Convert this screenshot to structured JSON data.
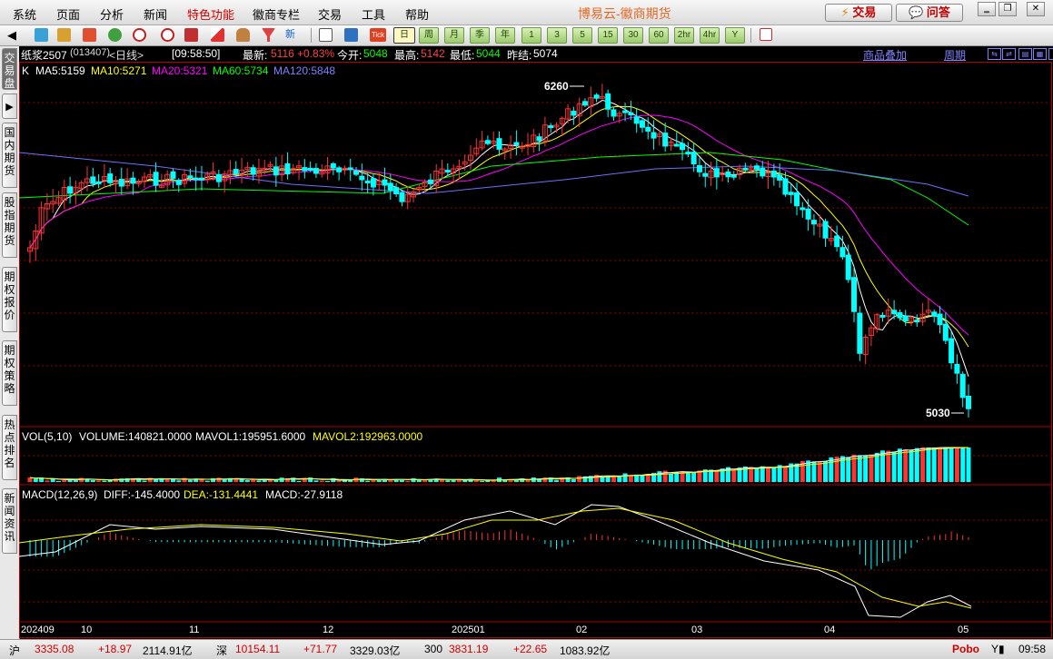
{
  "menu": {
    "items": [
      "系统",
      "页面",
      "分析",
      "新闻",
      "特色功能",
      "徽商专栏",
      "交易",
      "工具",
      "帮助"
    ],
    "highlight_index": 4,
    "app_title": "博易云-徽商期货",
    "trade_button": "交易",
    "qa_button": "问答"
  },
  "toolbar": {
    "periods": [
      "日",
      "周",
      "月",
      "季",
      "年",
      "1",
      "3",
      "5",
      "15",
      "30",
      "60",
      "2hr",
      "4hr",
      "Y"
    ],
    "selected_period": "日",
    "new_label": "新",
    "tick_label": "Tick"
  },
  "left_tabs": [
    "交易盘 3",
    "国内期货",
    "股指期货",
    "期权报价",
    "期权策略",
    "热点排名",
    "新闻资讯"
  ],
  "info": {
    "contract": "纸浆2507",
    "code": "(013407)",
    "period_label": "<日线>",
    "time": "[09:58:50]",
    "latest_label": "最新:",
    "latest": "5116",
    "change_pct": "+0.83%",
    "open_label": "今开:",
    "open": "5048",
    "high_label": "最高:",
    "high": "5142",
    "low_label": "最低:",
    "low": "5044",
    "prevsettle_label": "昨结:",
    "prevsettle": "5074",
    "overlay_link": "商品叠加",
    "period_link": "周期"
  },
  "ma_legend": {
    "k": "K",
    "ma5": "MA5:5159",
    "ma10": "MA10:5271",
    "ma20": "MA20:5321",
    "ma60": "MA60:5734",
    "ma120": "MA120:5848"
  },
  "vol_legend": {
    "name": "VOL(5,10)",
    "volume": "VOLUME:140821.0000",
    "mavol1": "MAVOL1:195951.6000",
    "mavol2": "MAVOL2:192963.0000"
  },
  "macd_legend": {
    "name": "MACD(12,26,9)",
    "diff": "DIFF:-145.4000",
    "dea": "DEA:-131.4441",
    "macd": "MACD:-27.9118"
  },
  "annotations": {
    "high_price": "6260",
    "low_price": "5030"
  },
  "x_axis_labels": [
    "202409",
    "10",
    "11",
    "12",
    "202501",
    "02",
    "03",
    "04",
    "05"
  ],
  "colors": {
    "up": "#ff3232",
    "down": "#00ffff",
    "ma5": "#ffffff",
    "ma10": "#ffff00",
    "ma20": "#ff00ff",
    "ma60": "#00ff00",
    "ma120": "#6f6fff"
  },
  "chart_data": {
    "type": "candlestick",
    "contract": "纸浆2507",
    "period": "daily",
    "date_range": [
      "2024-09",
      "2025-05"
    ],
    "price_ylim": [
      5000,
      6300
    ],
    "key_levels": {
      "high": 6260,
      "low": 5030
    },
    "last": {
      "latest": 5116,
      "open": 5048,
      "high": 5142,
      "low": 5044,
      "prev_settle": 5074
    },
    "volume": {
      "last": 140821,
      "mavol1": 195951.6,
      "mavol2": 192963
    },
    "macd": {
      "diff": -145.4,
      "dea": -131.4441,
      "macd": -27.9118
    }
  },
  "status": {
    "sh_label": "沪",
    "sh_index": "3335.08",
    "sh_change": "+18.97",
    "sh_amount": "2114.91亿",
    "sz_label": "深",
    "sz_index": "10154.11",
    "sz_change": "+71.77",
    "sz_amount": "3329.03亿",
    "c300_label": "300",
    "c300_index": "3831.19",
    "c300_change": "+22.65",
    "c300_amount": "1083.92亿",
    "brand": "Pobo",
    "clock": "09:58"
  }
}
